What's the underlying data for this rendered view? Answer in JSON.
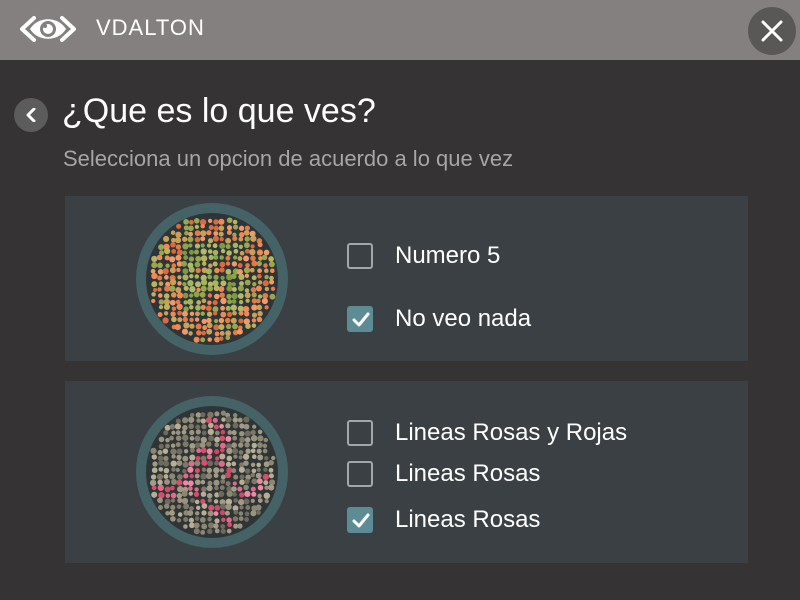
{
  "app": {
    "title": "VDALTON"
  },
  "page": {
    "title": "¿Que es lo que ves?",
    "subtitle": "Selecciona un opcion de acuerdo a lo que vez"
  },
  "questions": [
    {
      "plate_icon": "ishihara-plate-number",
      "options": [
        {
          "label": "Numero 5",
          "checked": false
        },
        {
          "label": "No veo nada",
          "checked": true
        }
      ]
    },
    {
      "plate_icon": "ishihara-plate-lines",
      "options": [
        {
          "label": "Lineas Rosas y Rojas",
          "checked": false
        },
        {
          "label": "Lineas Rosas",
          "checked": false
        },
        {
          "label": "Lineas Rosas",
          "checked": true
        }
      ]
    }
  ],
  "colors": {
    "header_bg": "#858080",
    "background": "#353333",
    "card_bg": "#3a4043",
    "accent": "#5e8c95",
    "plate_ring": "#456266"
  }
}
